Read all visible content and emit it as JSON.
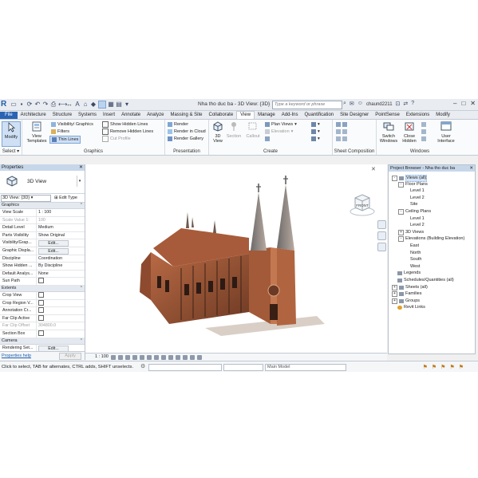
{
  "titlebar": {
    "logo": "R",
    "document_title": "Nha tho duc ba - 3D View: {3D}",
    "search_placeholder": "Type a keyword or phrase",
    "user": "chaund2211"
  },
  "tabs": [
    "File",
    "Architecture",
    "Structure",
    "Systems",
    "Insert",
    "Annotate",
    "Analyze",
    "Massing & Site",
    "Collaborate",
    "View",
    "Manage",
    "Add-Ins",
    "Quantification",
    "Site Designer",
    "PointSense",
    "Extensions",
    "Modify"
  ],
  "active_tab": "View",
  "ribbon": {
    "modify": "Modify",
    "select": "Select",
    "view_templates": "View Templates",
    "visibility_graphics": "Visibility/ Graphics",
    "filters": "Filters",
    "thin_lines": "Thin Lines",
    "show_hidden_lines": "Show Hidden Lines",
    "remove_hidden_lines": "Remove Hidden Lines",
    "cut_profile": "Cut Profile",
    "graphics_panel": "Graphics",
    "render": "Render",
    "render_in_cloud": "Render in Cloud",
    "render_gallery": "Render Gallery",
    "presentation_panel": "Presentation",
    "view_3d": "3D View",
    "section": "Section",
    "callout": "Callout",
    "plan_views": "Plan Views",
    "elevation": "Elevation",
    "create_panel": "Create",
    "sheet_composition_panel": "Sheet Composition",
    "switch_windows": "Switch Windows",
    "close_hidden": "Close Hidden",
    "user_interface": "User Interface",
    "windows_panel": "Windows"
  },
  "properties": {
    "header": "Properties",
    "type_name": "3D View",
    "view_selector": "3D View: {3D}",
    "edit_type": "Edit Type",
    "groups": {
      "graphics": "Graphics",
      "extents": "Extents",
      "camera": "Camera"
    },
    "graphics_rows": [
      {
        "k": "View Scale",
        "v": "1 : 100",
        "dim": false
      },
      {
        "k": "Scale Value    1:",
        "v": "100",
        "dim": true
      },
      {
        "k": "Detail Level",
        "v": "Medium",
        "dim": false
      },
      {
        "k": "Parts Visibility",
        "v": "Show Original",
        "dim": false
      },
      {
        "k": "Visibility/Grap...",
        "v": "Edit...",
        "dim": false,
        "btn": true
      },
      {
        "k": "Graphic Displa...",
        "v": "Edit...",
        "dim": false,
        "btn": true
      },
      {
        "k": "Discipline",
        "v": "Coordination",
        "dim": false
      },
      {
        "k": "Show Hidden ...",
        "v": "By Discipline",
        "dim": false
      },
      {
        "k": "Default Analys...",
        "v": "None",
        "dim": false
      },
      {
        "k": "Sun Path",
        "v": "",
        "dim": false,
        "cb": true
      }
    ],
    "extents_rows": [
      {
        "k": "Crop View",
        "v": "",
        "dim": false,
        "cb": true
      },
      {
        "k": "Crop Region V...",
        "v": "",
        "dim": false,
        "cb": true
      },
      {
        "k": "Annotation Cr...",
        "v": "",
        "dim": false,
        "cb": true
      },
      {
        "k": "Far Clip Active",
        "v": "",
        "dim": false,
        "cb": true
      },
      {
        "k": "Far Clip Offset",
        "v": "304800.0",
        "dim": true
      },
      {
        "k": "Section Box",
        "v": "",
        "dim": false,
        "cb": true
      }
    ],
    "camera_rows": [
      {
        "k": "Rendering Set...",
        "v": "Edit...",
        "dim": false,
        "btn": true
      }
    ],
    "help_link": "Properties help",
    "apply": "Apply"
  },
  "viewbar": {
    "scale": "1 : 100"
  },
  "viewcube": {
    "label": "FRONT"
  },
  "browser": {
    "header": "Project Browser - Nha tho duc ba",
    "nodes": [
      {
        "label": "Views (all)",
        "indent": 0,
        "toggle": "-",
        "selected": true
      },
      {
        "label": "Floor Plans",
        "indent": 1,
        "toggle": "-"
      },
      {
        "label": "Level 1",
        "indent": 2
      },
      {
        "label": "Level 2",
        "indent": 2
      },
      {
        "label": "Site",
        "indent": 2
      },
      {
        "label": "Ceiling Plans",
        "indent": 1,
        "toggle": "-"
      },
      {
        "label": "Level 1",
        "indent": 2
      },
      {
        "label": "Level 2",
        "indent": 2
      },
      {
        "label": "3D Views",
        "indent": 1,
        "toggle": "+"
      },
      {
        "label": "Elevations (Building Elevation)",
        "indent": 1,
        "toggle": "-"
      },
      {
        "label": "East",
        "indent": 2
      },
      {
        "label": "North",
        "indent": 2
      },
      {
        "label": "South",
        "indent": 2
      },
      {
        "label": "West",
        "indent": 2
      },
      {
        "label": "Legends",
        "indent": 0,
        "icon": true
      },
      {
        "label": "Schedules/Quantities (all)",
        "indent": 0,
        "icon": true
      },
      {
        "label": "Sheets (all)",
        "indent": 0,
        "toggle": "+",
        "icon": true
      },
      {
        "label": "Families",
        "indent": 0,
        "toggle": "+",
        "icon": true
      },
      {
        "label": "Groups",
        "indent": 0,
        "toggle": "+",
        "icon": true
      },
      {
        "label": "Revit Links",
        "indent": 0,
        "link": true
      }
    ]
  },
  "status": {
    "message": "Click to select, TAB for alternates, CTRL adds, SHIFT unselects.",
    "model": "Main Model"
  },
  "colors": {
    "accent": "#2a63b4",
    "panel_header": "#c7d7ea"
  }
}
